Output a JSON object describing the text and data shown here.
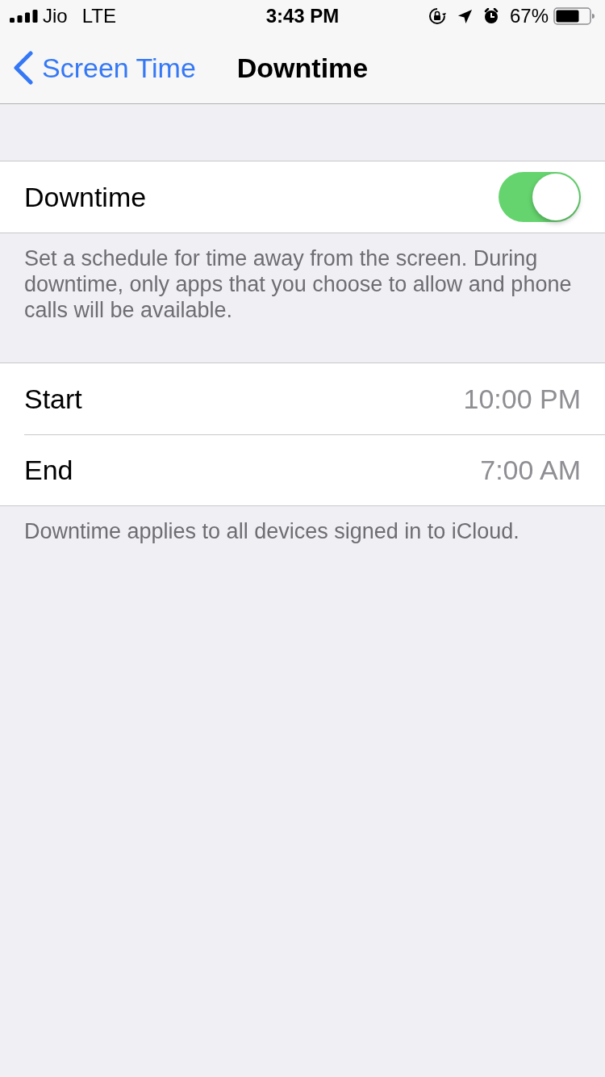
{
  "status_bar": {
    "carrier": "Jio",
    "network": "LTE",
    "time": "3:43 PM",
    "battery_percent": "67%"
  },
  "nav": {
    "back_label": "Screen Time",
    "title": "Downtime"
  },
  "sections": [
    {
      "rows": [
        {
          "kind": "toggle",
          "label": "Downtime",
          "on": true
        }
      ],
      "footer": "Set a schedule for time away from the screen. During downtime, only apps that you choose to allow and phone calls will be available."
    },
    {
      "rows": [
        {
          "kind": "value",
          "label": "Start",
          "value": "10:00 PM"
        },
        {
          "kind": "value",
          "label": "End",
          "value": "7:00 AM"
        }
      ],
      "footer": "Downtime applies to all devices signed in to iCloud."
    }
  ]
}
